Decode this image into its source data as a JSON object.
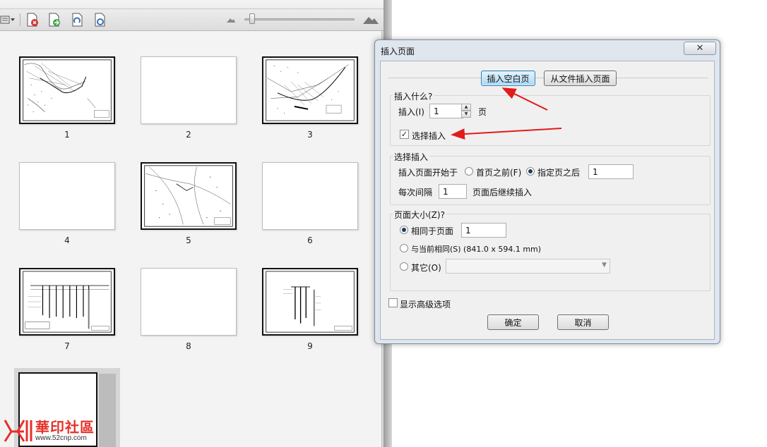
{
  "thumbnails": [
    {
      "label": "1"
    },
    {
      "label": "2"
    },
    {
      "label": "3"
    },
    {
      "label": "4"
    },
    {
      "label": "5"
    },
    {
      "label": "6"
    },
    {
      "label": "7"
    },
    {
      "label": "8"
    },
    {
      "label": "9"
    }
  ],
  "watermark": {
    "brand": "華印社區",
    "url": "www.52cnp.com"
  },
  "dialog": {
    "title": "插入页面",
    "close_label": "✕",
    "tabs": [
      {
        "label": "插入空白页",
        "active": true
      },
      {
        "label": "从文件插入页面",
        "active": false
      }
    ],
    "what_group": {
      "title": "插入什么?",
      "insert_label": "插入(I)",
      "insert_value": "1",
      "unit": "页",
      "select_insert_label": "选择插入",
      "select_insert_checked": true
    },
    "select_group": {
      "title": "选择插入",
      "start_label": "插入页面开始于",
      "before_first_label": "首页之前(F)",
      "after_page_label": "指定页之后",
      "after_page_value": "1",
      "interval_label": "每次间隔",
      "interval_value": "1",
      "continue_label": "页面后继续插入"
    },
    "size_group": {
      "title": "页面大小(Z)?",
      "same_as_page_label": "相同于页面",
      "same_as_page_value": "1",
      "same_as_current_label": "与当前相同(S) (841.0 x 594.1 mm)",
      "other_label": "其它(O)"
    },
    "advanced_label": "显示高级选项",
    "ok_label": "确定",
    "cancel_label": "取消"
  },
  "colors": {
    "annotation_arrow": "#e21b1b",
    "active_tab": "#a9d8f3"
  }
}
